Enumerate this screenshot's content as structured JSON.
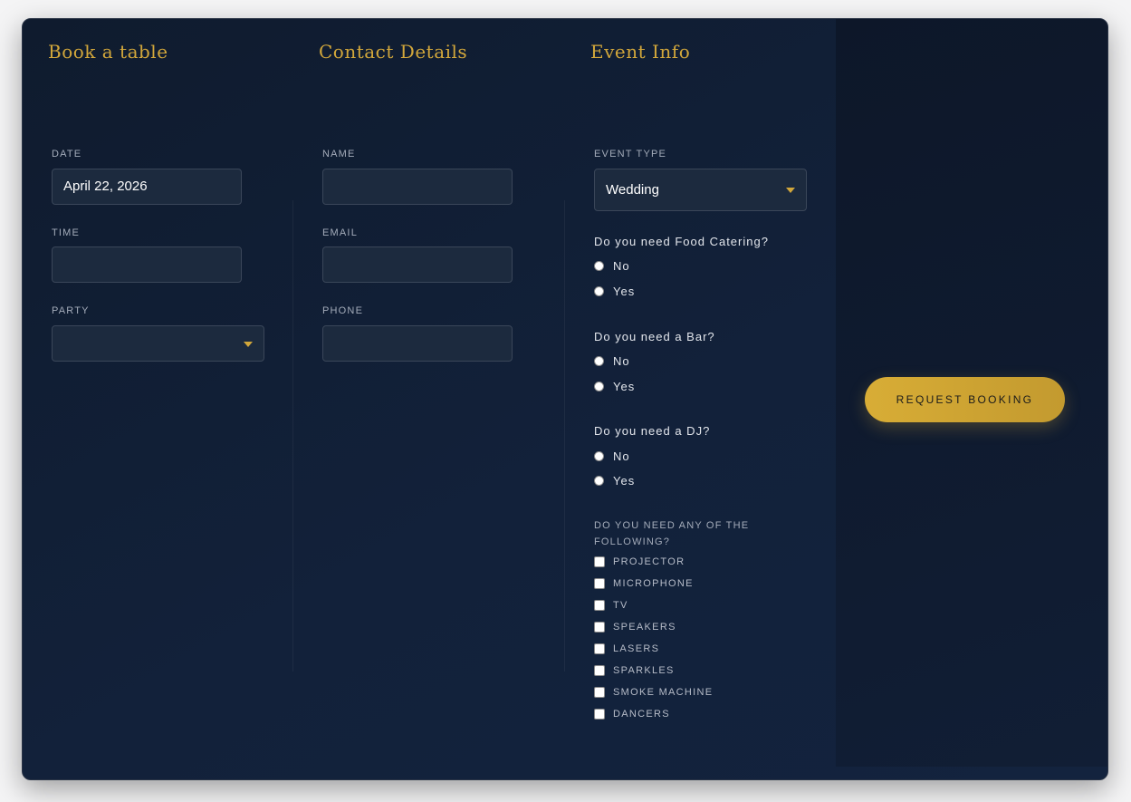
{
  "columns": {
    "booking": {
      "title": "Book a table",
      "date_label": "DATE",
      "date_value": "April 22, 2026",
      "time_label": "TIME",
      "time_value": "",
      "party_label": "PARTY",
      "party_value": ""
    },
    "contact": {
      "title": "Contact Details",
      "name_label": "NAME",
      "name_value": "",
      "email_label": "EMAIL",
      "email_value": "",
      "phone_label": "PHONE",
      "phone_value": ""
    },
    "event": {
      "title": "Event Info",
      "type_label": "EVENT TYPE",
      "type_value": "Wedding",
      "questions": [
        {
          "text": "Do you need Food Catering?",
          "options": [
            "No",
            "Yes"
          ]
        },
        {
          "text": "Do you need a Bar?",
          "options": [
            "No",
            "Yes"
          ]
        },
        {
          "text": "Do you need a DJ?",
          "options": [
            "No",
            "Yes"
          ]
        }
      ],
      "extras_label": "DO YOU NEED ANY OF THE FOLLOWING?",
      "extras": [
        "PROJECTOR",
        "MICROPHONE",
        "TV",
        "SPEAKERS",
        "LASERS",
        "SPARKLES",
        "SMOKE MACHINE",
        "DANCERS"
      ]
    }
  },
  "submit": {
    "label": "REQUEST BOOKING"
  },
  "colors": {
    "accent": "#d2a73b",
    "panel": "#12213a",
    "input_bg": "#1c2a3e"
  },
  "icons": {
    "select_arrow": "caret-down-icon"
  }
}
